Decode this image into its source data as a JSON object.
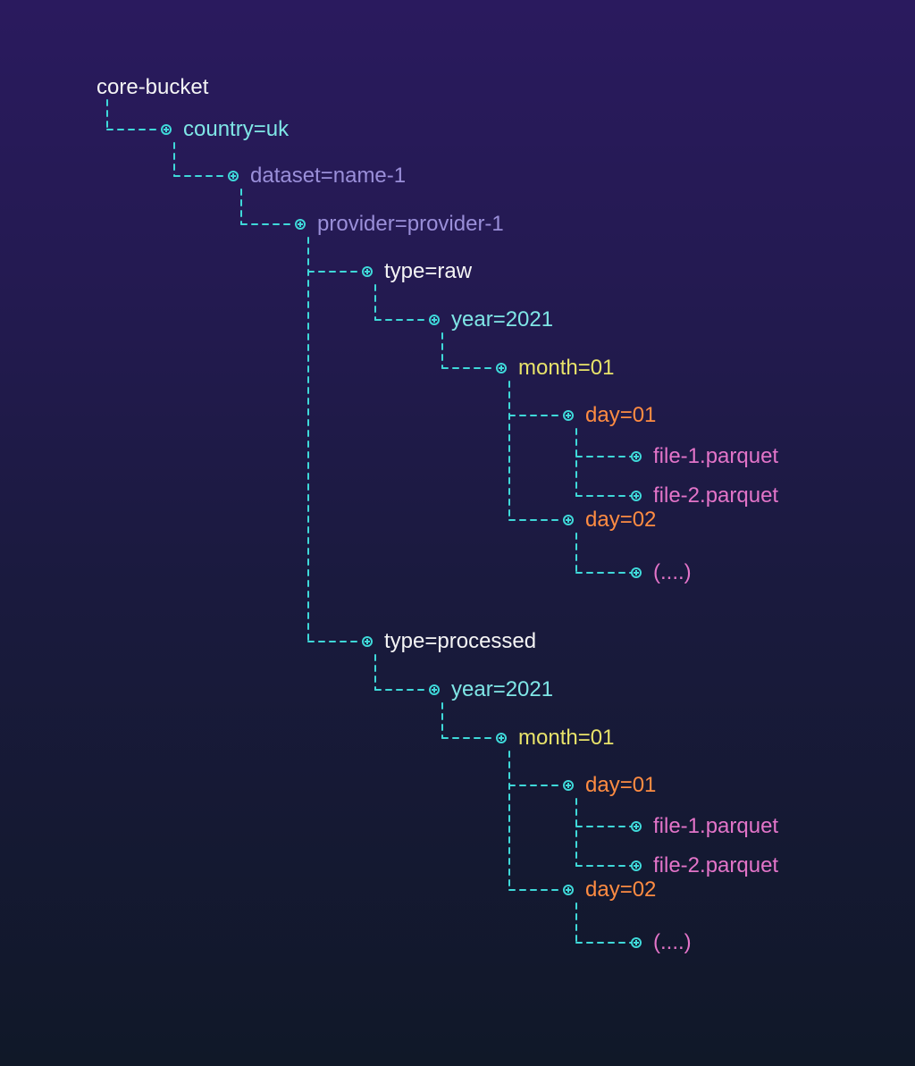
{
  "tree": {
    "root": "core-bucket",
    "country": "country=uk",
    "dataset": "dataset=name-1",
    "provider": "provider=provider-1",
    "type_raw": "type=raw",
    "type_processed": "type=processed",
    "year_raw": "year=2021",
    "year_processed": "year=2021",
    "month_raw": "month=01",
    "month_processed": "month=01",
    "day_raw_1": "day=01",
    "day_raw_2": "day=02",
    "day_processed_1": "day=01",
    "day_processed_2": "day=02",
    "file_raw_1": "file-1.parquet",
    "file_raw_2": "file-2.parquet",
    "file_processed_1": "file-1.parquet",
    "file_processed_2": "file-2.parquet",
    "ellipsis_raw": "(....)",
    "ellipsis_processed": "(....)"
  },
  "colors": {
    "white": "#f5f5f5",
    "cyan": "#7fe6e6",
    "purple": "#9a8fd9",
    "yellow": "#e8e36a",
    "orange": "#ff8c42",
    "pink": "#e374c9",
    "connector": "#3fd9d9"
  }
}
